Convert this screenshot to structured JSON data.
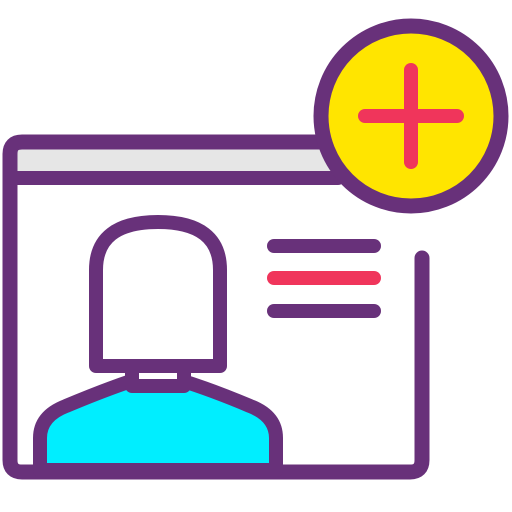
{
  "icon": {
    "name": "add-user-profile-icon",
    "components": [
      "browser-window-icon",
      "user-avatar-icon",
      "text-lines-icon",
      "plus-badge-icon"
    ]
  },
  "colors": {
    "outline": "#68317A",
    "window_fill": "#FFFFFF",
    "title_bar_fill": "#E6E6E6",
    "avatar_head_fill": "#FFFFFF",
    "avatar_body_fill": "#00EEFF",
    "accent_line": "#F0355B",
    "badge_fill": "#FFE500",
    "plus_sign": "#F0355B"
  }
}
